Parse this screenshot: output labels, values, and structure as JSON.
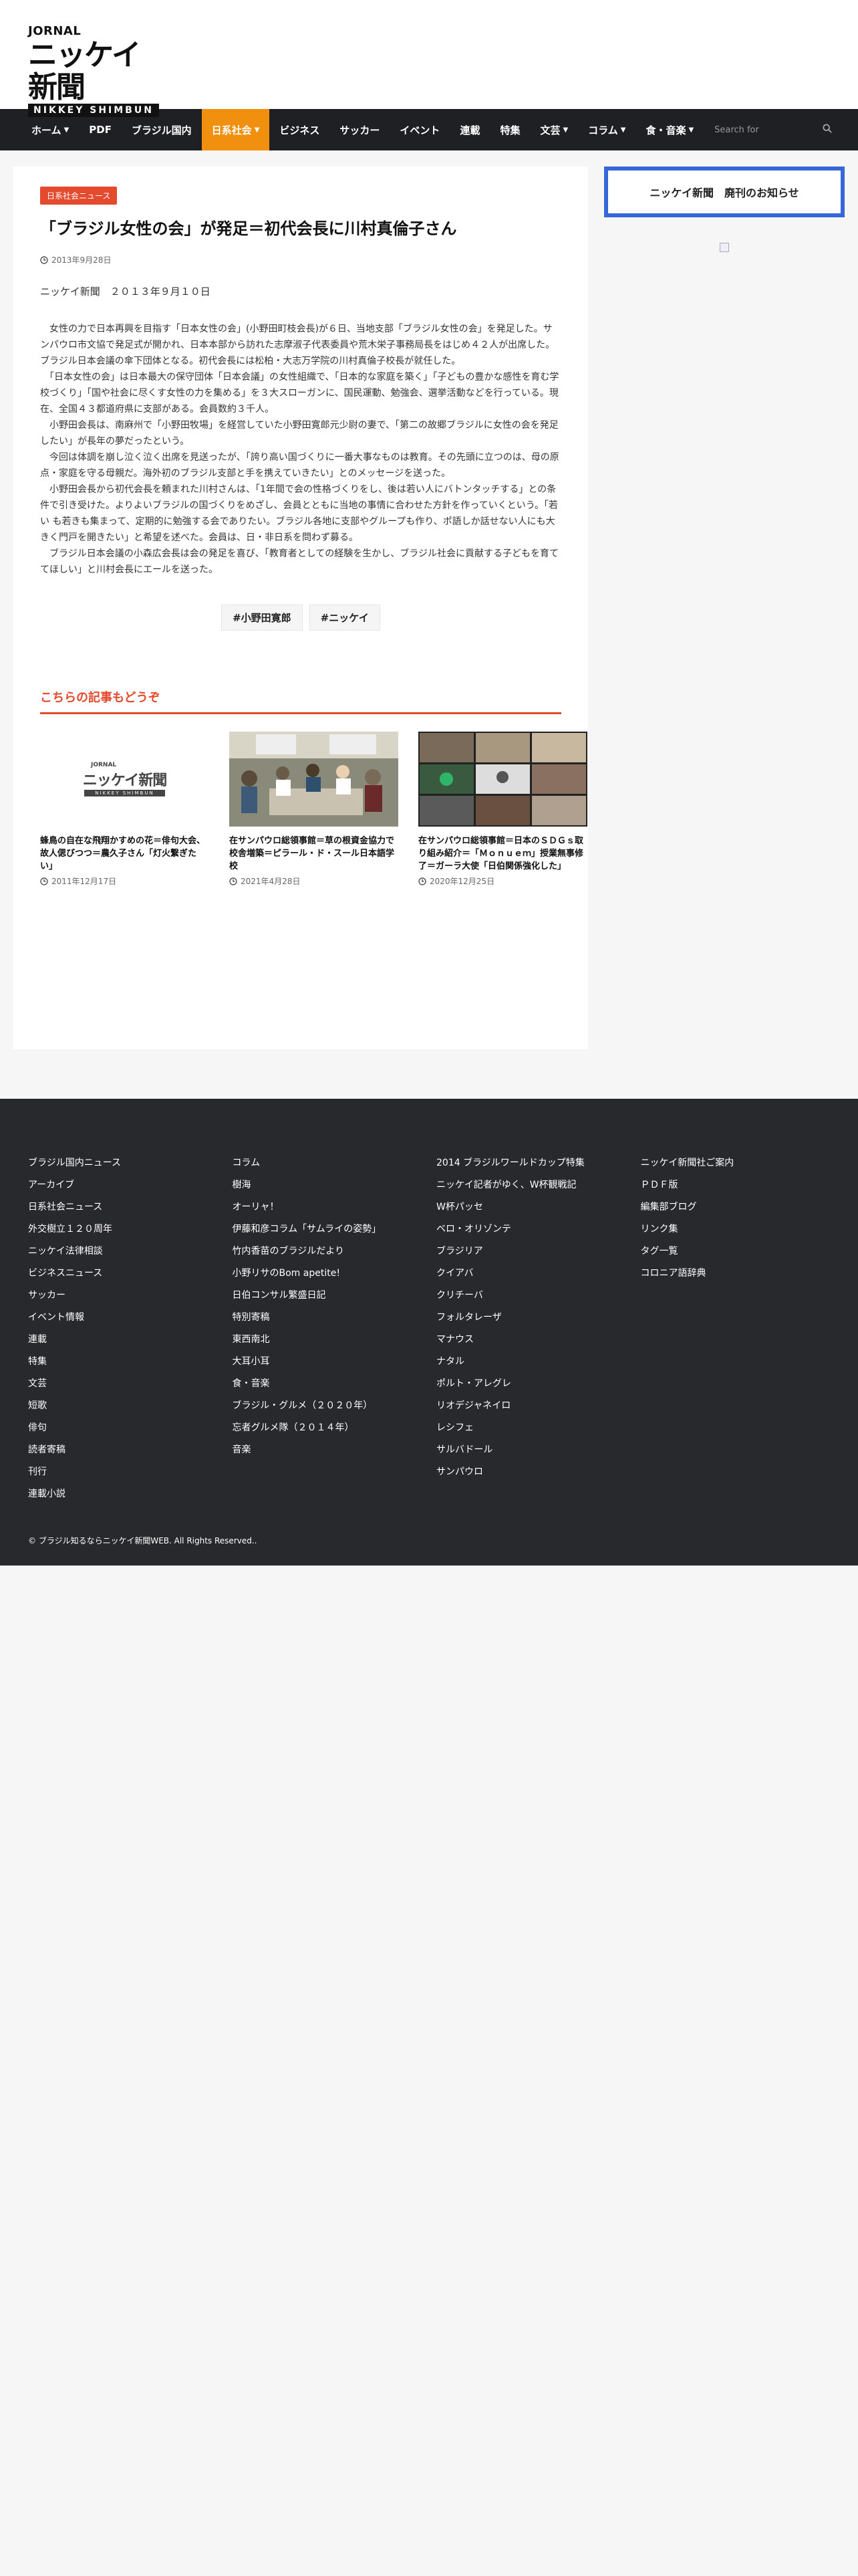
{
  "header": {
    "logo_top": "JORNAL",
    "logo_main": "ニッケイ新聞",
    "logo_sub": "NIKKEY SHIMBUN"
  },
  "nav": {
    "items": [
      {
        "label": "ホーム",
        "dropdown": true
      },
      {
        "label": "PDF",
        "dropdown": false
      },
      {
        "label": "ブラジル国内",
        "dropdown": false
      },
      {
        "label": "日系社会",
        "dropdown": true,
        "active": true
      },
      {
        "label": "ビジネス",
        "dropdown": false
      },
      {
        "label": "サッカー",
        "dropdown": false
      },
      {
        "label": "イベント",
        "dropdown": false
      },
      {
        "label": "連載",
        "dropdown": false
      },
      {
        "label": "特集",
        "dropdown": false
      },
      {
        "label": "文芸",
        "dropdown": true
      },
      {
        "label": "コラム",
        "dropdown": true
      },
      {
        "label": "食・音楽",
        "dropdown": true
      }
    ],
    "search_placeholder": "Search for"
  },
  "article": {
    "category": "日系社会ニュース",
    "title": "「ブラジル女性の会」が発足＝初代会長に川村真倫子さん",
    "date": "2013年9月28日",
    "byline": "ニッケイ新聞　２０１３年９月１０日",
    "paragraphs": [
      "　女性の力で日本再興を目指す「日本女性の会」(小野田町枝会長)が６日、当地支部「ブラジル女性の会」を発足した。サンパウロ市文協で発足式が開かれ、日本本部から訪れた志摩淑子代表委員や荒木栄子事務局長をはじめ４２人が出席した。ブラジル日本会議の傘下団体となる。初代会長には松柏・大志万学院の川村真倫子校長が就任した。",
      "　「日本女性の会」は日本最大の保守団体「日本会議」の女性組織で、「日本的な家庭を築く」「子どもの豊かな感性を育む学校づくり」「国や社会に尽くす女性の力を集める」を３大スローガンに、国民運動、勉強会、選挙活動などを行っている。現在、全国４３都道府県に支部がある。会員数約３千人。",
      "　小野田会長は、南麻州で「小野田牧場」を経営していた小野田寛郎元少尉の妻で、「第二の故郷ブラジルに女性の会を発足したい」が長年の夢だったという。",
      "　今回は体調を崩し泣く泣く出席を見送ったが、「誇り高い国づくりに一番大事なものは教育。その先頭に立つのは、母の原点・家庭を守る母親だ。海外初のブラジル支部と手を携えていきたい」とのメッセージを送った。",
      "　小野田会長から初代会長を頼まれた川村さんは、「1年間で会の性格づくりをし、後は若い人にバトンタッチする」との条件で引き受けた。よりよいブラジルの国づくりをめざし、会員とともに当地の事情に合わせた方針を作っていくという。「若い も若きも集まって、定期的に勉強する会でありたい。ブラジル各地に支部やグループも作り、ポ語しか話せない人にも大きく門戸を開きたい」と希望を述べた。会員は、日・非日系を問わず募る。",
      "　ブラジル日本会議の小森広会長は会の発足を喜び、「教育者としての経験を生かし、ブラジル社会に貢献する子どもを育ててほしい」と川村会長にエールを送った。"
    ],
    "tags": [
      "#小野田寛郎",
      "#ニッケイ"
    ]
  },
  "related": {
    "heading": "こちらの記事もどうぞ",
    "posts": [
      {
        "title": "蜂鳥の自在な飛翔かすめの花＝俳句大会、故人偲びつつ＝農久子さん「灯火繋ぎたい」",
        "date": "2011年12月17日",
        "thumb": "logo"
      },
      {
        "title": "在サンパウロ総領事館＝草の根資金協力で校舎増築＝ピラール・ド・スール日本語学校",
        "date": "2021年4月28日",
        "thumb": "meeting"
      },
      {
        "title": "在サンパウロ総領事館＝日本のＳＤＧｓ取り組み紹介＝「Ｍｏｎｕｅｍ」授業無事修了＝ガーラ大使「日伯関係強化した」",
        "date": "2020年12月25日",
        "thumb": "video"
      }
    ]
  },
  "sidebar": {
    "notice": "ニッケイ新聞　廃刊のお知らせ"
  },
  "footer": {
    "col1": [
      "ブラジル国内ニュース",
      "アーカイブ",
      "日系社会ニュース",
      "外交樹立１２０周年",
      "ニッケイ法律相談",
      "ビジネスニュース",
      "サッカー",
      "イベント情報",
      "連載",
      "特集",
      "文芸",
      "短歌",
      "俳句",
      "読者寄稿",
      "刊行",
      "連載小説"
    ],
    "col2": [
      "コラム",
      "樹海",
      "オーリャ！",
      "伊藤和彦コラム「サムライの姿勢」",
      "竹内香苗のブラジルだより",
      "小野リサのBom apetite!",
      "日伯コンサル繁盛日記",
      "特別寄稿",
      "東西南北",
      "大耳小耳",
      "食・音楽",
      "ブラジル・グルメ（２０２０年）",
      "忘者グルメ隊（２０１４年）",
      "音楽"
    ],
    "col3": [
      "2014 ブラジルワールドカップ特集",
      "ニッケイ記者がゆく、W杯観戦記",
      "W杯パッセ",
      "ベロ・オリゾンテ",
      "ブラジリア",
      "クイアバ",
      "クリチーバ",
      "フォルタレーザ",
      "マナウス",
      "ナタル",
      "ポルト・アレグレ",
      "リオデジャネイロ",
      "レシフェ",
      "サルバドール",
      "サンパウロ"
    ],
    "col4": [
      "ニッケイ新聞社ご案内",
      "ＰＤＦ版",
      "編集部ブログ",
      "リンク集",
      "タグ一覧",
      "コロニア語辞典"
    ],
    "copyright": "© ブラジル知るならニッケイ新聞WEB. All Rights Reserved.."
  }
}
